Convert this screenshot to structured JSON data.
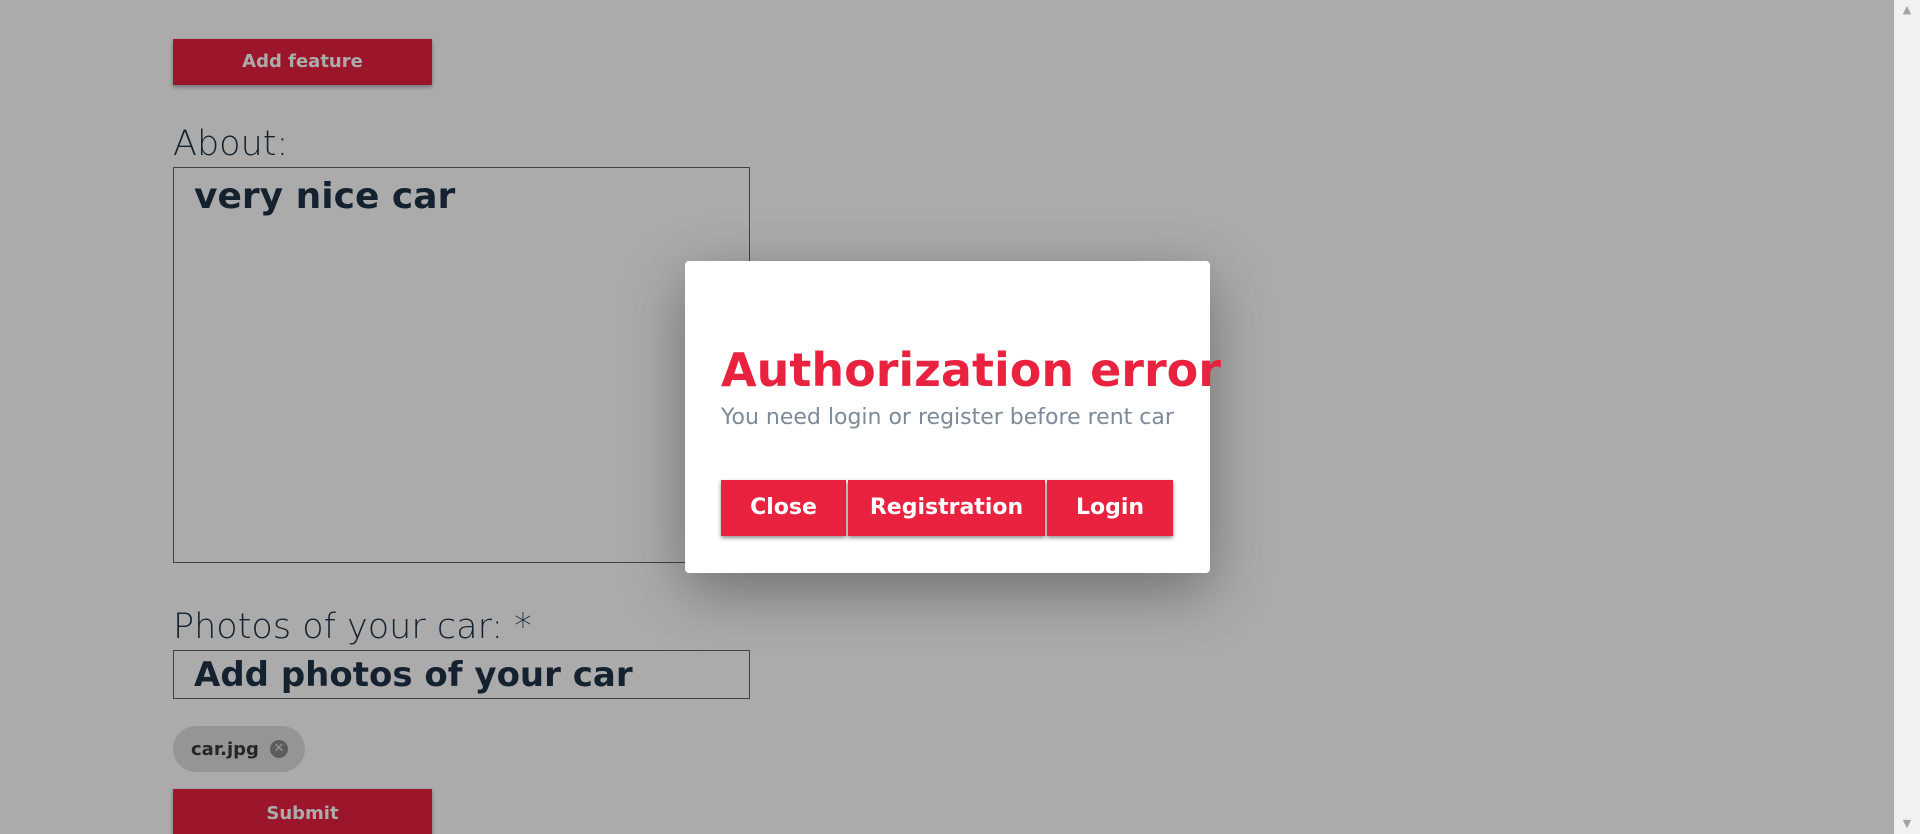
{
  "form": {
    "add_feature_label": "Add feature",
    "about_label": "About:",
    "about_value": "very nice car",
    "photos_label": "Photos of your car: *",
    "photos_input_text": "Add photos of your car",
    "uploaded_file": "car.jpg",
    "submit_label": "Submit"
  },
  "modal": {
    "title": "Authorization error",
    "message": "You need login or register before rent car",
    "close_label": "Close",
    "registration_label": "Registration",
    "login_label": "Login"
  },
  "colors": {
    "accent": "#e8223f",
    "text_dark": "#1f3347",
    "muted_text": "#7d8a99"
  },
  "icons": {
    "chip_remove": "close-circle-icon",
    "scroll_up": "triangle-up-icon",
    "scroll_down": "triangle-down-icon"
  }
}
